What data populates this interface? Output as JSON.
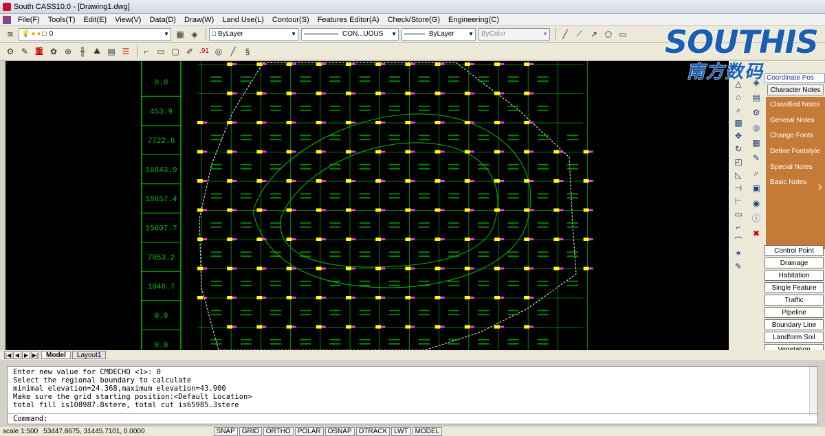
{
  "window": {
    "title": "South CASS10.0 - [Drawing1.dwg]"
  },
  "menu": [
    "File(F)",
    "Tools(T)",
    "Edit(E)",
    "View(V)",
    "Data(D)",
    "Draw(W)",
    "Land Use(L)",
    "Contour(S)",
    "Features Editor(A)",
    "Check/Store(G)",
    "Engineering(C)"
  ],
  "toolbar": {
    "layer_value": "0",
    "color_combo": "ByLayer",
    "linetype_combo": "CON...UOUS",
    "lineweight_combo": "ByLayer",
    "plotstyle_combo": "ByColor",
    "tool2_text": ".91"
  },
  "brand": {
    "name": "SOUTHIS",
    "name_cn": "南方数码"
  },
  "drawing": {
    "table_values": [
      "0.0",
      "453.9",
      "7722.6",
      "16843.9",
      "18657.4",
      "15607.7",
      "7053.2",
      "1046.7",
      "0.0",
      "0.0"
    ],
    "accent_green": "#00c000",
    "boundary_color": "#d8d8d8",
    "marker_yellow": "#ffff00",
    "marker_magenta": "#ff30ff"
  },
  "panel": {
    "coord_pos": "Coordinate Pos",
    "char_notes": "Character Notes",
    "notes": [
      "Classified Notes",
      "General Notes",
      "Change Fonts",
      "Define Fontstyle",
      "Special Notes",
      "Basic Notes"
    ],
    "categories": [
      "Control Point",
      "Drainage",
      "Habitation",
      "Single Feature",
      "Traffic",
      "Pipeline",
      "Boundary Line",
      "Landform Soil",
      "Vegetation"
    ]
  },
  "tabs": {
    "model": "Model",
    "layout": "Layout1"
  },
  "command": {
    "history": [
      "Enter new value for CMDECHO <1>: 0",
      "Select the regional boundary to calculate",
      "minimal elevation=24.368,maximum elevation=43.900",
      "Make sure the grid starting position:<Default Location>",
      "total fill is108987.8stere, total cut is65985.3stere"
    ],
    "prompt": "Command:"
  },
  "status": {
    "scale": "scale 1:500",
    "coords": "53447.8675, 31445.7101, 0.0000",
    "buttons": [
      "SNAP",
      "GRID",
      "ORTHO",
      "POLAR",
      "OSNAP",
      "OTRACK",
      "LWT",
      "MODEL"
    ]
  }
}
